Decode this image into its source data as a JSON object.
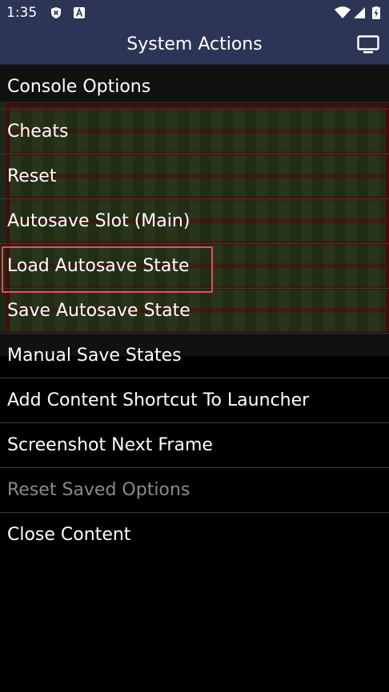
{
  "status_bar": {
    "time": "1:35",
    "icons": [
      "shield-x-icon",
      "a-badge-icon",
      "wifi-icon",
      "signal-icon",
      "battery-charging-icon"
    ]
  },
  "header": {
    "title": "System Actions",
    "right_icon": "tv-icon"
  },
  "menu": {
    "items": [
      {
        "label": "Console Options",
        "enabled": true
      },
      {
        "label": "Cheats",
        "enabled": true
      },
      {
        "label": "Reset",
        "enabled": true
      },
      {
        "label": "Autosave Slot (Main)",
        "enabled": true,
        "highlighted": true
      },
      {
        "label": "Load Autosave State",
        "enabled": true
      },
      {
        "label": "Save Autosave State",
        "enabled": true
      },
      {
        "label": "Manual Save States",
        "enabled": true
      },
      {
        "label": "Add Content Shortcut To Launcher",
        "enabled": true
      },
      {
        "label": "Screenshot Next Frame",
        "enabled": true
      },
      {
        "label": "Reset Saved Options",
        "enabled": false
      },
      {
        "label": "Close Content",
        "enabled": true
      }
    ]
  },
  "colors": {
    "bar": "#2c3555",
    "highlight": "#e45050",
    "disabled_text": "#8a8a8a"
  }
}
